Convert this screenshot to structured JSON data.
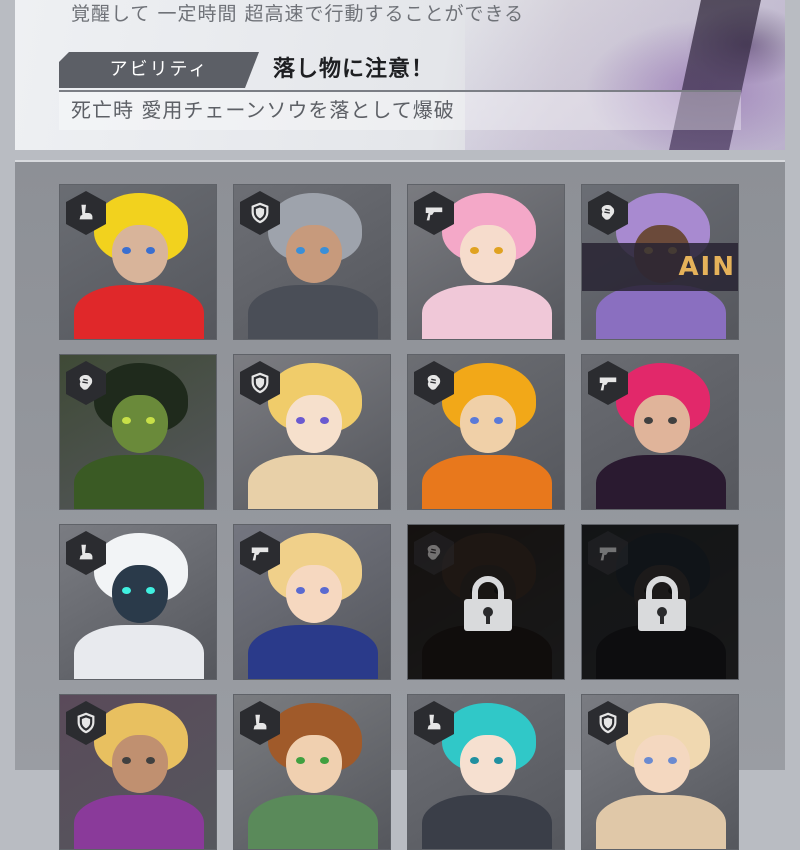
{
  "info": {
    "skill_description": "覚醒して 一定時間 超高速で行動することができる",
    "ability_label": "アビリティ",
    "ability_name": "落し物に注意！",
    "ability_description": "死亡時 愛用チェーンソウを落として爆破"
  },
  "colors": {
    "badge_bg": "#2b2c30",
    "badge_icon": "#e6e6e6",
    "panel_bg": "#e4e6ea",
    "grid_bg": "#8d9096"
  },
  "grid": {
    "cards": [
      {
        "role": "speed-icon",
        "locked": false,
        "bg": "#6a6d73",
        "hair": "#f2d21e",
        "face": "#d8b49a",
        "eye": "#3a6fd0",
        "body": "#e0282a",
        "text": ""
      },
      {
        "role": "shield-icon",
        "locked": false,
        "bg": "#6d6f75",
        "hair": "#9ea3ac",
        "face": "#c79a7c",
        "eye": "#3a8fd8",
        "body": "#4a4e57",
        "text": ""
      },
      {
        "role": "gun-icon",
        "locked": false,
        "bg": "#7a7b80",
        "hair": "#f4a8c8",
        "face": "#f6dccc",
        "eye": "#e0a220",
        "body": "#f0c8d8",
        "text": ""
      },
      {
        "role": "fist-icon",
        "locked": false,
        "bg": "#6b6e75",
        "hair": "#a88ad0",
        "face": "#6b4a3a",
        "eye": "#e8c040",
        "body": "#8a6fc0",
        "text": "AIN"
      },
      {
        "role": "fist-icon",
        "locked": false,
        "bg": "#3f4a36",
        "hair": "#1f2a1c",
        "face": "#6a8a3a",
        "eye": "#c8e048",
        "body": "#3a5a24",
        "text": ""
      },
      {
        "role": "shield-icon",
        "locked": false,
        "bg": "#7c7d82",
        "hair": "#f0cc6a",
        "face": "#f6e0cc",
        "eye": "#6a5ad0",
        "body": "#e8d0a8",
        "text": ""
      },
      {
        "role": "fist-icon",
        "locked": false,
        "bg": "#6c6e73",
        "hair": "#f2a818",
        "face": "#f0d0a8",
        "eye": "#5a7ad8",
        "body": "#e8781c",
        "text": ""
      },
      {
        "role": "gun-icon",
        "locked": false,
        "bg": "#6a6c72",
        "hair": "#e2286a",
        "face": "#e0b49a",
        "eye": "#404040",
        "body": "#2a1a30",
        "text": ""
      },
      {
        "role": "speed-icon",
        "locked": false,
        "bg": "#7a7c82",
        "hair": "#f2f4f6",
        "face": "#2a3a4a",
        "eye": "#40f0e0",
        "body": "#e8eaee",
        "text": ""
      },
      {
        "role": "gun-icon",
        "locked": false,
        "bg": "#747680",
        "hair": "#f0d08a",
        "face": "#f6d8c0",
        "eye": "#5a6ad0",
        "body": "#2a3a8a",
        "text": ""
      },
      {
        "role": "fist-icon",
        "locked": true,
        "bg": "#5a3a2a",
        "hair": "#8a4a2a",
        "face": "#6a4a3a",
        "eye": "#303030",
        "body": "#4a2a20",
        "text": ""
      },
      {
        "role": "gun-icon",
        "locked": true,
        "bg": "#3a4a5a",
        "hair": "#2a4a6a",
        "face": "#6a5a5a",
        "eye": "#303030",
        "body": "#2a3040",
        "text": ""
      },
      {
        "role": "shield-icon",
        "locked": false,
        "bg": "#5a4a5a",
        "hair": "#e8c060",
        "face": "#c09070",
        "eye": "#404040",
        "body": "#8a3a9a",
        "text": ""
      },
      {
        "role": "speed-icon",
        "locked": false,
        "bg": "#7a7c80",
        "hair": "#a05a2a",
        "face": "#f0d0b0",
        "eye": "#40a040",
        "body": "#5a8a5a",
        "text": ""
      },
      {
        "role": "speed-icon",
        "locked": false,
        "bg": "#6e7076",
        "hair": "#30c8c8",
        "face": "#f6e0d0",
        "eye": "#2090a0",
        "body": "#3a3e48",
        "text": ""
      },
      {
        "role": "shield-icon",
        "locked": false,
        "bg": "#7a7c82",
        "hair": "#f0d8b0",
        "face": "#f4d8c0",
        "eye": "#6a8ad0",
        "body": "#e0c8a8",
        "text": ""
      }
    ]
  }
}
